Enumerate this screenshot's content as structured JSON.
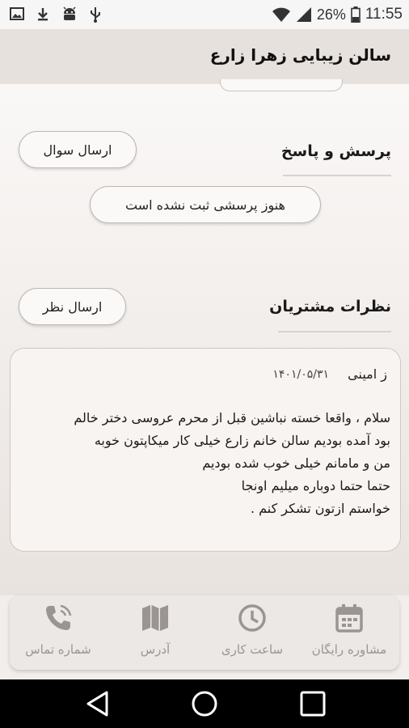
{
  "status_bar": {
    "battery": "26%",
    "time": "11:55"
  },
  "app_bar": {
    "title": "سالن زیبایی زهرا زارع"
  },
  "qa": {
    "title": "پرسش و پاسخ",
    "ask_button": "ارسال سوال",
    "empty_text": "هنوز پرسشی ثبت نشده است"
  },
  "reviews": {
    "title": "نظرات مشتریان",
    "submit_button": "ارسال نظر",
    "items": [
      {
        "author": "ز امینی",
        "date": "۱۴۰۱/۰۵/۳۱",
        "lines": [
          "سلام ، واقعا خسته نباشین قبل از محرم عروسی دختر خالم",
          "بود آمده بودیم سالن خانم زارع خیلی کار میکاپتون خوبه",
          " من و مامانم خیلی خوب شده بودیم",
          "حتما حتما دوباره میلیم اونجا",
          "خواستم ازتون تشکر کنم ."
        ]
      }
    ]
  },
  "bottom_nav": [
    {
      "label": "مشاوره رایگان",
      "icon": "calendar-icon"
    },
    {
      "label": "ساعت کاری",
      "icon": "clock-icon"
    },
    {
      "label": "آدرس",
      "icon": "map-icon"
    },
    {
      "label": "شماره تماس",
      "icon": "phone-call-icon"
    }
  ],
  "colors": {
    "app_bar": "#e7e1dd",
    "content_top": "#faf8f7",
    "content_bottom": "#e9e3df",
    "nav_icon": "#9a9592",
    "system_nav": "#000000"
  }
}
